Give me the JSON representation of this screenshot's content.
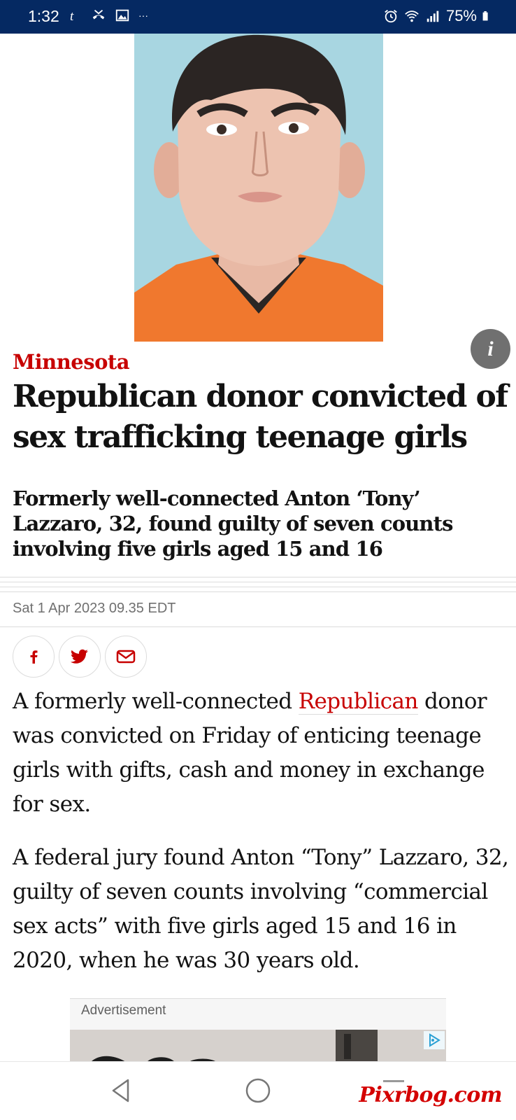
{
  "status_bar": {
    "time": "1:32",
    "more": "···",
    "battery": "75%",
    "bg_color": "#052962"
  },
  "hero": {
    "photo_description_icon": "info-icon",
    "info_label": "i"
  },
  "article": {
    "kicker": "Minnesota",
    "headline": "Republican donor convicted of sex trafficking teenage girls",
    "standfirst": "Formerly well-connected Anton ‘Tony’ Lazzaro, 32, found guilty of seven counts involving five girls aged 15 and 16",
    "dateline": "Sat 1 Apr 2023 09.35 EDT",
    "share": [
      "facebook-icon",
      "twitter-icon",
      "email-icon"
    ],
    "p1_before": "A formerly well-connected ",
    "p1_link": "Republican",
    "p1_after": " donor was convicted on Friday of enticing teenage girls with gifts, cash and money in exchange for sex.",
    "p2": "A federal jury found Anton “Tony” Lazzaro, 32, guilty of seven counts involving “commercial sex acts” with five girls aged 15 and 16 in 2020, when he was 30 years old.",
    "accent_color": "#c70000"
  },
  "ad": {
    "label": "Advertisement"
  },
  "nav": {
    "buttons": [
      "back-icon",
      "home-icon",
      "recents-icon"
    ],
    "watermark": "Pixrbog.com"
  }
}
